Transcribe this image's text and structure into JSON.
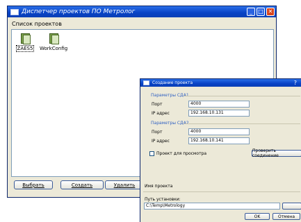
{
  "main_window": {
    "title": "Диспетчер проектов ПО Метролог",
    "list_label": "Список проектов",
    "projects": [
      {
        "label": "ZAES5"
      },
      {
        "label": "WorkConfig"
      }
    ],
    "buttons": {
      "select": "Выбрать",
      "create": "Создать",
      "delete": "Удалить"
    }
  },
  "dialog": {
    "title": "Создание проекта",
    "help": "?",
    "group1": {
      "label": "Параметры СДА1",
      "port_label": "Порт",
      "port_value": "4000",
      "ip_label": "IP адрес",
      "ip_value": "192.168.10.131"
    },
    "group2": {
      "label": "Параметры СДА2",
      "port_label": "Порт",
      "port_value": "4000",
      "ip_label": "IP адрес",
      "ip_value": "192.168.10.141"
    },
    "view_only_label": "Проект для просмотра",
    "check_button": "Проверить соединение",
    "project_name_label": "Имя проекта",
    "install_path_label": "Путь установки:",
    "install_path_value": "C:\\Temp\\Metrology",
    "browse_button": "",
    "ok_button": "OK",
    "cancel_button": "Отмена"
  }
}
